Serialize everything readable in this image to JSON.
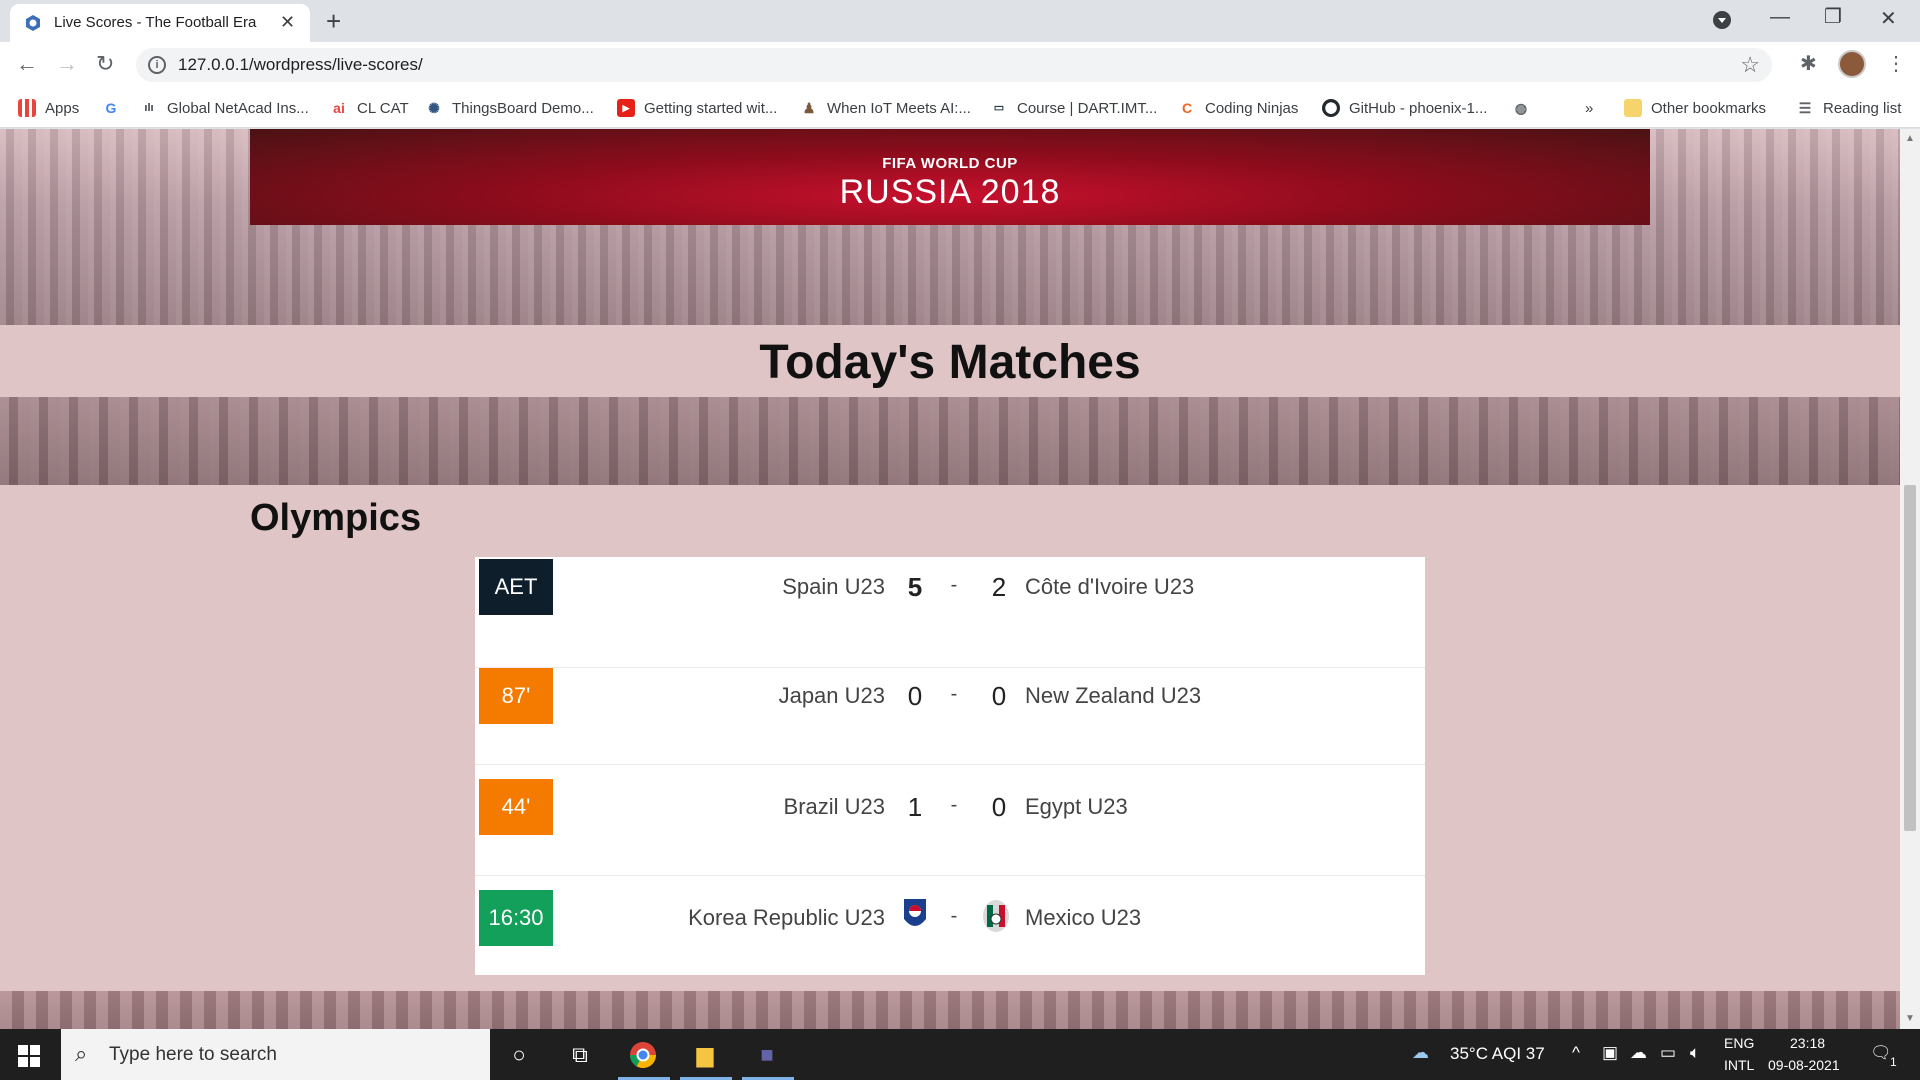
{
  "browser": {
    "tab_title": "Live Scores - The Football Era",
    "url": "127.0.0.1/wordpress/live-scores/",
    "bookmarks": [
      {
        "label": "Apps",
        "icon": "apps-grid-icon"
      },
      {
        "label": "",
        "icon": "google-icon"
      },
      {
        "label": "Global NetAcad Ins...",
        "icon": "cisco-icon"
      },
      {
        "label": "CL CAT",
        "icon": "ai-icon"
      },
      {
        "label": "ThingsBoard Demo...",
        "icon": "thingsboard-icon"
      },
      {
        "label": "Getting started wit...",
        "icon": "youtube-icon"
      },
      {
        "label": "When IoT Meets AI:...",
        "icon": "person-icon"
      },
      {
        "label": "Course | DART.IMT...",
        "icon": "course-icon"
      },
      {
        "label": "Coding Ninjas",
        "icon": "coding-ninjas-icon"
      },
      {
        "label": "GitHub - phoenix-1...",
        "icon": "github-icon"
      },
      {
        "label": "",
        "icon": "globe-icon"
      }
    ],
    "overflow_label": "»",
    "other_bookmarks": "Other bookmarks",
    "reading_list": "Reading list"
  },
  "page": {
    "banner": {
      "line1": "FIFA WORLD CUP",
      "line2": "RUSSIA 2018"
    },
    "heading": "Today's Matches",
    "league": "Olympics",
    "matches": [
      {
        "status": "AET",
        "status_color": "#0e1f2b",
        "home": "Spain U23",
        "home_score": "5",
        "sep": "-",
        "away_score": "2",
        "away": "Côte d'Ivoire U23"
      },
      {
        "status": "87'",
        "status_color": "#f47b00",
        "home": "Japan U23",
        "home_score": "0",
        "sep": "-",
        "away_score": "0",
        "away": "New Zealand U23"
      },
      {
        "status": "44'",
        "status_color": "#f47b00",
        "home": "Brazil U23",
        "home_score": "1",
        "sep": "-",
        "away_score": "0",
        "away": "Egypt U23"
      },
      {
        "status": "16:30",
        "status_color": "#12a05a",
        "home": "Korea Republic U23",
        "home_score": "",
        "sep": "-",
        "away_score": "",
        "away": "Mexico U23",
        "home_crest": "korea-crest-icon",
        "away_crest": "mexico-crest-icon"
      }
    ]
  },
  "taskbar": {
    "search_placeholder": "Type here to search",
    "weather": "35°C  AQI 37",
    "lang1": "ENG",
    "lang2": "INTL",
    "time": "23:18",
    "date": "09-08-2021",
    "notification_count": "1"
  }
}
